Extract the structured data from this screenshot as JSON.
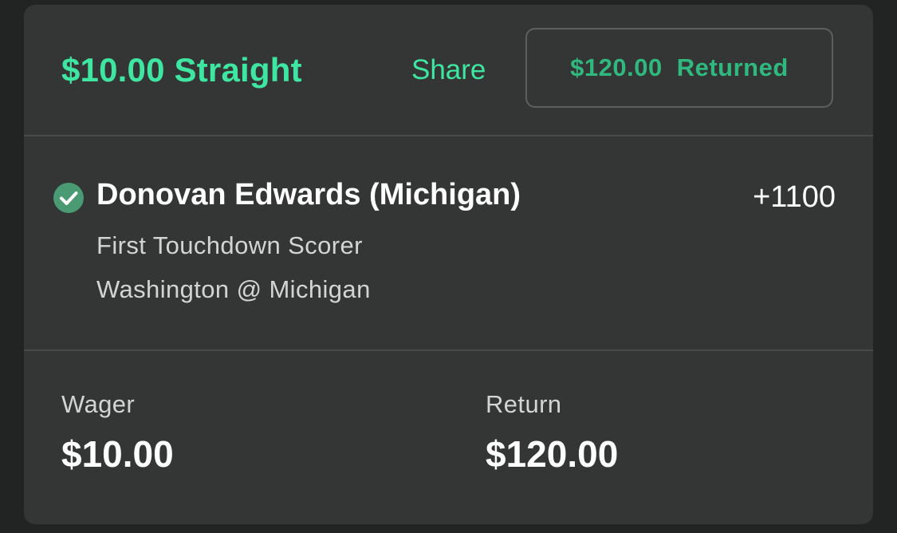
{
  "bet": {
    "title": "$10.00 Straight",
    "share_label": "Share",
    "returned_amount": "$120.00",
    "returned_label": "Returned"
  },
  "selection": {
    "status_icon": "check-circle-icon",
    "player": "Donovan Edwards (Michigan)",
    "odds": "+1100",
    "market": "First Touchdown Scorer",
    "event": "Washington @ Michigan"
  },
  "summary": {
    "wager_label": "Wager",
    "wager_value": "$10.00",
    "return_label": "Return",
    "return_value": "$120.00"
  },
  "colors": {
    "accent": "#3ee6a1",
    "returned": "#2fb97f",
    "check": "#4a9b73",
    "card": "#333635",
    "background": "#222323"
  }
}
